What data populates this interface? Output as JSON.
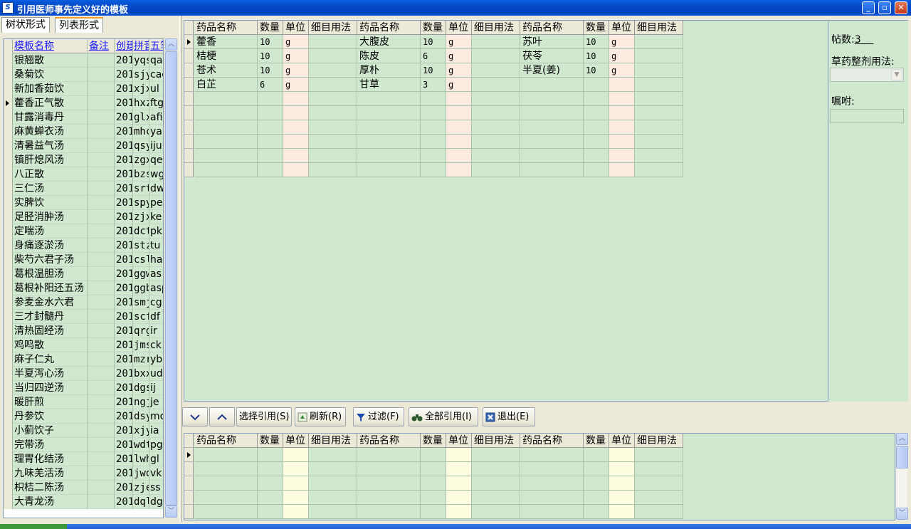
{
  "window": {
    "title": "引用医师事先定义好的模板",
    "icon_label": "S",
    "minimize_icon": "minimize-icon",
    "maximize_icon": "maximize-icon",
    "close_icon": "close-icon"
  },
  "left": {
    "tabs": [
      {
        "label": "树状形式"
      },
      {
        "label": "列表形式"
      }
    ],
    "columns": [
      "模板名称",
      "备注",
      "创建",
      "拼音",
      "五笔"
    ],
    "rows": [
      {
        "name": "银翘散",
        "note": "",
        "created": "201",
        "pinyin": "yqs",
        "wubi": "qaa"
      },
      {
        "name": "桑菊饮",
        "note": "",
        "created": "201",
        "pinyin": "sjy",
        "wubi": "cac"
      },
      {
        "name": "新加香茹饮",
        "note": "",
        "created": "201",
        "pinyin": "xjx",
        "wubi": "ul"
      },
      {
        "name": "藿香正气散",
        "note": "",
        "created": "201",
        "pinyin": "hxz",
        "wubi": "ftg"
      },
      {
        "name": "甘露消毒丹",
        "note": "",
        "created": "201",
        "pinyin": "glx",
        "wubi": "afi"
      },
      {
        "name": "麻黄蝉衣汤",
        "note": "",
        "created": "201",
        "pinyin": "mhc",
        "wubi": "ya"
      },
      {
        "name": "清暑益气汤",
        "note": "",
        "created": "201",
        "pinyin": "qsy",
        "wubi": "iju"
      },
      {
        "name": "镇肝熄风汤",
        "note": "",
        "created": "201",
        "pinyin": "zgx",
        "wubi": "qe"
      },
      {
        "name": "八正散",
        "note": "",
        "created": "201",
        "pinyin": "bzs",
        "wubi": "wga"
      },
      {
        "name": "三仁汤",
        "note": "",
        "created": "201",
        "pinyin": "srt",
        "wubi": "dw"
      },
      {
        "name": "实脾饮",
        "note": "",
        "created": "201",
        "pinyin": "spy",
        "wubi": "pe"
      },
      {
        "name": "足胫消肿汤",
        "note": "",
        "created": "201",
        "pinyin": "zjx",
        "wubi": "ke"
      },
      {
        "name": "定喘汤",
        "note": "",
        "created": "201",
        "pinyin": "dct",
        "wubi": "pk"
      },
      {
        "name": "身痛逐淤汤",
        "note": "",
        "created": "201",
        "pinyin": "stz",
        "wubi": "tu"
      },
      {
        "name": "柴芍六君子汤",
        "note": "",
        "created": "201",
        "pinyin": "csl",
        "wubi": "ha"
      },
      {
        "name": "葛根温胆汤",
        "note": "",
        "created": "201",
        "pinyin": "ggw",
        "wubi": "as"
      },
      {
        "name": "葛根补阳还五汤",
        "note": "",
        "created": "201",
        "pinyin": "ggb",
        "wubi": "asp"
      },
      {
        "name": "参麦金水六君",
        "note": "",
        "created": "201",
        "pinyin": "smj",
        "wubi": "cg"
      },
      {
        "name": "三才封髓丹",
        "note": "",
        "created": "201",
        "pinyin": "scf",
        "wubi": "df"
      },
      {
        "name": "清热固经汤",
        "note": "",
        "created": "201",
        "pinyin": "qrg",
        "wubi": "ir"
      },
      {
        "name": "鸡鸣散",
        "note": "",
        "created": "201",
        "pinyin": "jms",
        "wubi": "ck"
      },
      {
        "name": "麻子仁丸",
        "note": "",
        "created": "201",
        "pinyin": "mzr",
        "wubi": "yb"
      },
      {
        "name": "半夏泻心汤",
        "note": "",
        "created": "201",
        "pinyin": "bxx",
        "wubi": "ud"
      },
      {
        "name": "当归四逆汤",
        "note": "",
        "created": "201",
        "pinyin": "dgs",
        "wubi": "ij"
      },
      {
        "name": "暖肝煎",
        "note": "",
        "created": "201",
        "pinyin": "ngj",
        "wubi": "je"
      },
      {
        "name": "丹参饮",
        "note": "",
        "created": "201",
        "pinyin": "dsy",
        "wubi": "mc"
      },
      {
        "name": "小蓟饮子",
        "note": "",
        "created": "201",
        "pinyin": "xjy",
        "wubi": "ia"
      },
      {
        "name": "完带汤",
        "note": "",
        "created": "201",
        "pinyin": "wdt",
        "wubi": "pg"
      },
      {
        "name": "理胃化结汤",
        "note": "",
        "created": "201",
        "pinyin": "lwh",
        "wubi": "gl"
      },
      {
        "name": "九味羌活汤",
        "note": "",
        "created": "201",
        "pinyin": "jwq",
        "wubi": "vk"
      },
      {
        "name": "枳桔二陈汤",
        "note": "",
        "created": "201",
        "pinyin": "zje",
        "wubi": "ss"
      },
      {
        "name": "大青龙汤",
        "note": "",
        "created": "201",
        "pinyin": "dql",
        "wubi": "dg"
      }
    ],
    "selected_row": 3
  },
  "top_grid": {
    "columns": [
      "药品名称",
      "数量",
      "单位",
      "细目用法",
      "药品名称",
      "数量",
      "单位",
      "细目用法",
      "药品名称",
      "数量",
      "单位",
      "细目用法"
    ],
    "rows": [
      [
        {
          "name": "藿香",
          "qty": "10",
          "unit": "g",
          "usage": ""
        },
        {
          "name": "大腹皮",
          "qty": "10",
          "unit": "g",
          "usage": ""
        },
        {
          "name": "苏叶",
          "qty": "10",
          "unit": "g",
          "usage": ""
        }
      ],
      [
        {
          "name": "桔梗",
          "qty": "10",
          "unit": "g",
          "usage": ""
        },
        {
          "name": "陈皮",
          "qty": "6",
          "unit": "g",
          "usage": ""
        },
        {
          "name": "茯苓",
          "qty": "10",
          "unit": "g",
          "usage": ""
        }
      ],
      [
        {
          "name": "苍术",
          "qty": "10",
          "unit": "g",
          "usage": ""
        },
        {
          "name": "厚朴",
          "qty": "10",
          "unit": "g",
          "usage": ""
        },
        {
          "name": "半夏(姜)",
          "qty": "10",
          "unit": "g",
          "usage": ""
        }
      ],
      [
        {
          "name": "白芷",
          "qty": "6",
          "unit": "g",
          "usage": ""
        },
        {
          "name": "甘草",
          "qty": "3",
          "unit": "g",
          "usage": ""
        },
        {
          "name": "",
          "qty": "",
          "unit": "",
          "usage": ""
        }
      ]
    ]
  },
  "right": {
    "doses_label": "帖数:",
    "doses_value": "3",
    "usage_label": "草药整剂用法:",
    "usage_value": "",
    "instruction_label": "嘱咐:",
    "instruction_value": ""
  },
  "toolbar": {
    "down_icon": "chevron-down-icon",
    "up_icon": "chevron-up-icon",
    "select_ref": "选择引用(S)",
    "refresh": "刷新(R)",
    "filter": "过滤(F)",
    "ref_all": "全部引用(I)",
    "exit": "退出(E)"
  },
  "bottom_grid": {
    "columns": [
      "药品名称",
      "数量",
      "单位",
      "细目用法",
      "药品名称",
      "数量",
      "单位",
      "细目用法",
      "药品名称",
      "数量",
      "单位",
      "细目用法"
    ]
  }
}
